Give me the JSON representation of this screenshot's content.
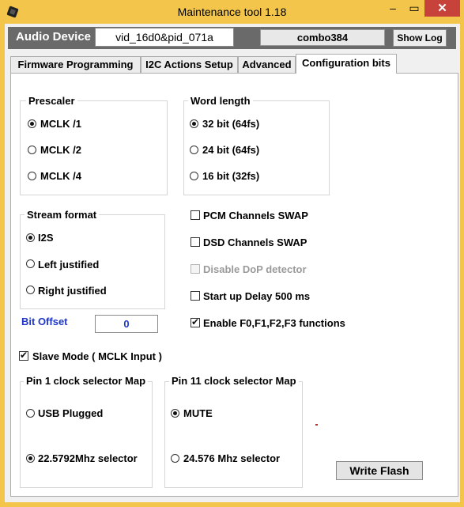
{
  "window": {
    "title": "Maintenance tool 1.18",
    "close_glyph": "✕",
    "minimize_glyph": "–",
    "maximize_glyph": "▭",
    "icon": "chip-icon"
  },
  "device_bar": {
    "label": "Audio Device",
    "device_id": "vid_16d0&pid_071a",
    "chip": "combo384",
    "show_log": "Show Log"
  },
  "tabs": [
    {
      "label": "Firmware Programming",
      "active": false
    },
    {
      "label": "I2C Actions Setup",
      "active": false
    },
    {
      "label": "Advanced",
      "active": false
    },
    {
      "label": "Configuration bits",
      "active": true
    }
  ],
  "prescaler": {
    "title": "Prescaler",
    "options": [
      "MCLK /1",
      "MCLK /2",
      "MCLK /4"
    ],
    "selected": 0
  },
  "word_length": {
    "title": "Word length",
    "options": [
      "32 bit (64fs)",
      "24 bit (64fs)",
      "16 bit (32fs)"
    ],
    "selected": 0
  },
  "stream_format": {
    "title": "Stream format",
    "options": [
      "I2S",
      "Left justified",
      "Right justified"
    ],
    "selected": 0
  },
  "checkboxes": [
    {
      "label": "PCM Channels SWAP",
      "checked": false,
      "enabled": true
    },
    {
      "label": "DSD Channels SWAP",
      "checked": false,
      "enabled": true
    },
    {
      "label": "Disable DoP detector",
      "checked": false,
      "enabled": false
    },
    {
      "label": "Start up Delay 500 ms",
      "checked": false,
      "enabled": true
    },
    {
      "label": "Enable F0,F1,F2,F3 functions",
      "checked": true,
      "enabled": true
    }
  ],
  "bit_offset": {
    "label": "Bit Offset",
    "value": "0"
  },
  "slave_mode": {
    "label": "Slave Mode ( MCLK Input )",
    "checked": true
  },
  "pin1": {
    "title": "Pin 1 clock selector Map",
    "options": [
      "USB Plugged",
      "22.5792Mhz selector"
    ],
    "selected": 1
  },
  "pin11": {
    "title": "Pin 11 clock selector Map",
    "options": [
      "MUTE",
      "24.576 Mhz selector"
    ],
    "selected": 0
  },
  "write_flash": "Write Flash",
  "colors": {
    "title_bar": "#f3c54a",
    "close_button": "#c7423a",
    "device_bar": "#6a6a6a",
    "link_blue": "#1f36c9"
  }
}
